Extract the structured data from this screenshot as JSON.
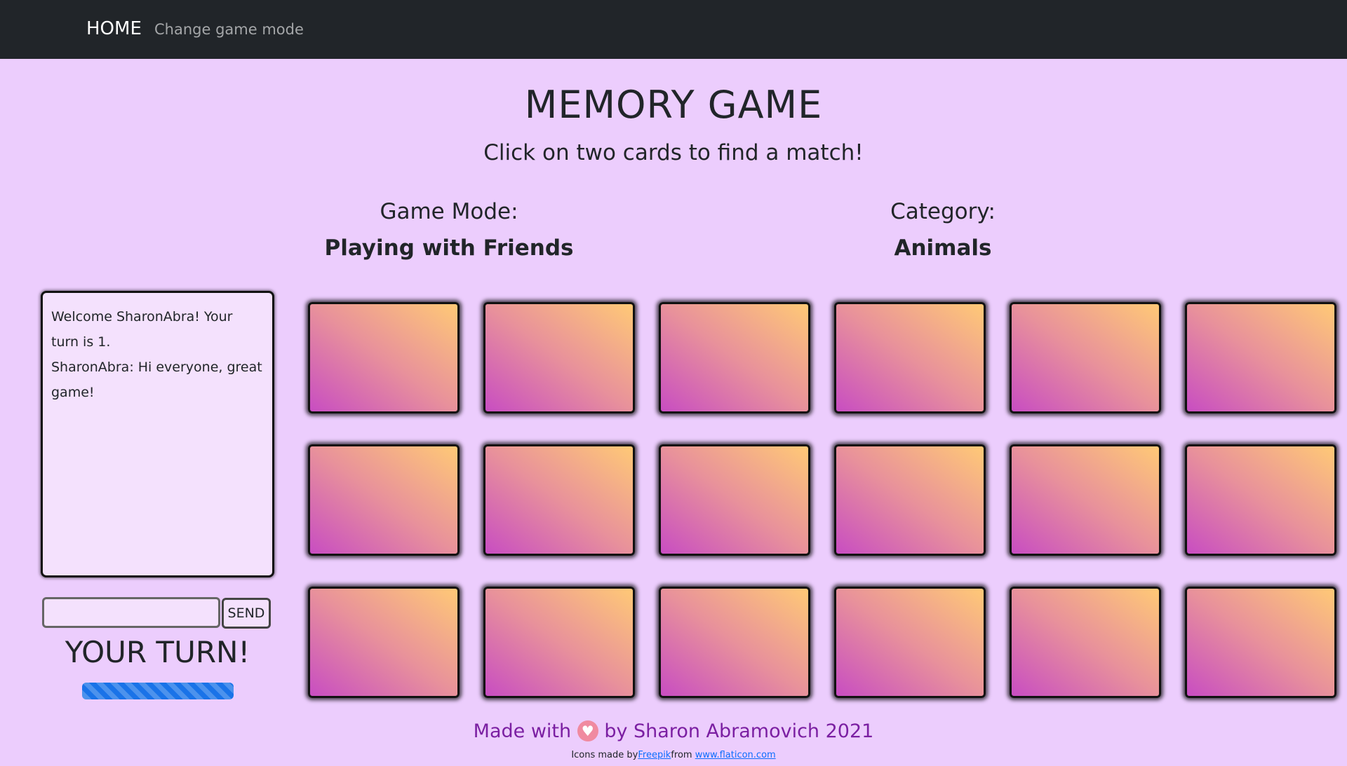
{
  "nav": {
    "home_label": "HOME",
    "mode_label": "Change game mode"
  },
  "header": {
    "title": "MEMORY GAME",
    "subtitle": "Click on two cards to find a match!"
  },
  "game_info": {
    "mode_label": "Game Mode:",
    "mode_value": "Playing with Friends",
    "category_label": "Category:",
    "category_value": "Animals"
  },
  "chat": {
    "messages": [
      "Welcome SharonAbra! Your turn is 1.",
      "SharonAbra: Hi everyone, great game!"
    ],
    "input_value": "",
    "send_label": "SEND"
  },
  "turn": {
    "label": "YOUR TURN!",
    "progress_percent": 100,
    "progress_color": "#1a73e8"
  },
  "board": {
    "rows": 3,
    "columns": 6,
    "card_count": 18,
    "card_state": "face-down"
  },
  "footer": {
    "made_with_prefix": "Made with",
    "made_with_suffix": "by Sharon Abramovich 2021",
    "heart_icon": "heart-icon",
    "credits_prefix": "Icons made by",
    "credits_author": "Freepik",
    "credits_from": "from",
    "credits_site": "www.flaticon.com"
  },
  "colors": {
    "background": "#eccdfd",
    "navbar": "#212529",
    "footer_text": "#7b1fa2",
    "card_gradient_start": "#c84dc2",
    "card_gradient_end": "#ffc976"
  }
}
